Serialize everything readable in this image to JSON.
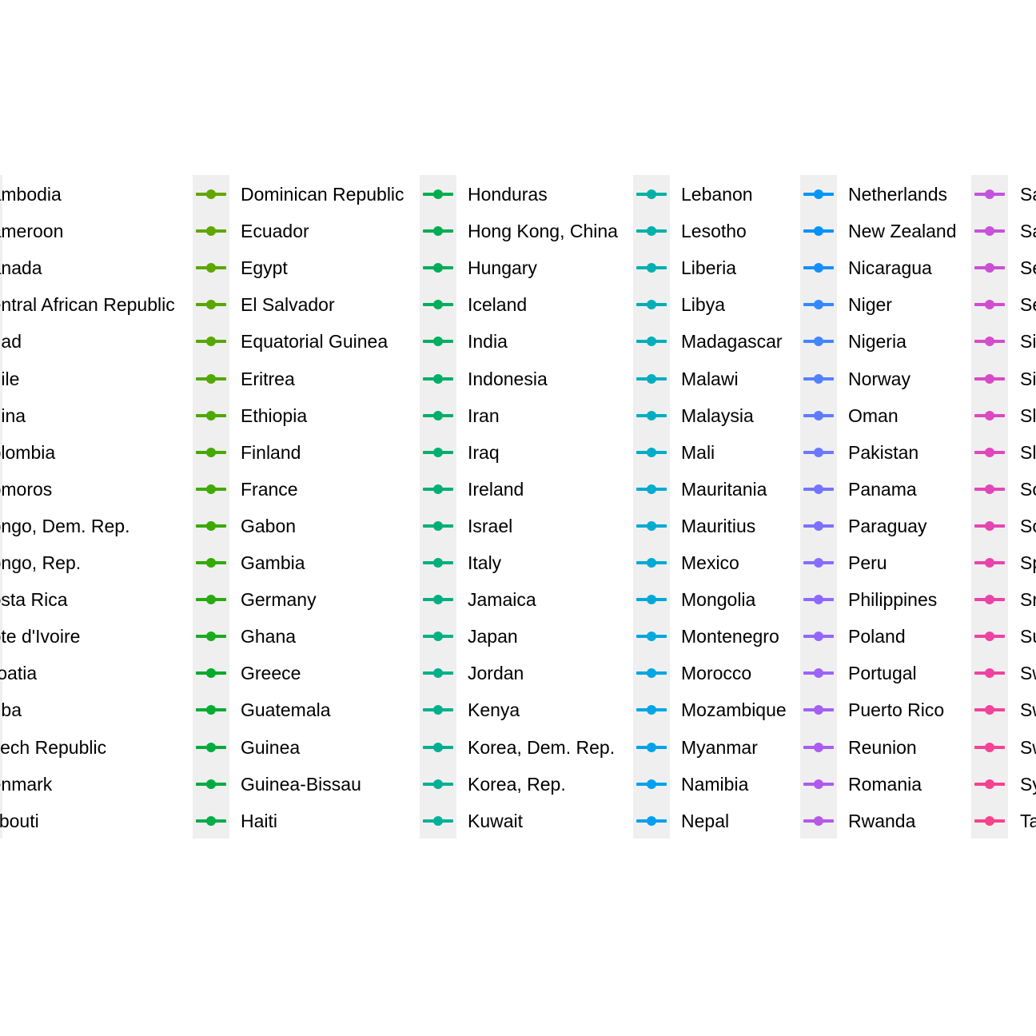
{
  "chart_data": {
    "type": "line",
    "legend_position": "center",
    "legend_columns": [
      {
        "entries": [
          {
            "name": "Cambodia",
            "color": "#8b9a00"
          },
          {
            "name": "Cameroon",
            "color": "#8a9b00"
          },
          {
            "name": "Canada",
            "color": "#889c00"
          },
          {
            "name": "Central African Republic",
            "color": "#869c00"
          },
          {
            "name": "Chad",
            "color": "#849d00"
          },
          {
            "name": "Chile",
            "color": "#829e00"
          },
          {
            "name": "China",
            "color": "#809f00"
          },
          {
            "name": "Colombia",
            "color": "#7e9f00"
          },
          {
            "name": "Comoros",
            "color": "#7ca000"
          },
          {
            "name": "Congo, Dem. Rep.",
            "color": "#7aa100"
          },
          {
            "name": "Congo, Rep.",
            "color": "#78a100"
          },
          {
            "name": "Costa Rica",
            "color": "#75a200"
          },
          {
            "name": "Cote d'Ivoire",
            "color": "#73a300"
          },
          {
            "name": "Croatia",
            "color": "#71a300"
          },
          {
            "name": "Cuba",
            "color": "#6ea400"
          },
          {
            "name": "Czech Republic",
            "color": "#6ba400"
          },
          {
            "name": "Denmark",
            "color": "#69a500"
          },
          {
            "name": "Djibouti",
            "color": "#66a500"
          }
        ]
      },
      {
        "entries": [
          {
            "name": "Dominican Republic",
            "color": "#63a600"
          },
          {
            "name": "Ecuador",
            "color": "#60a600"
          },
          {
            "name": "Egypt",
            "color": "#5ca700"
          },
          {
            "name": "El Salvador",
            "color": "#59a700"
          },
          {
            "name": "Equatorial Guinea",
            "color": "#55a800"
          },
          {
            "name": "Eritrea",
            "color": "#51a800"
          },
          {
            "name": "Ethiopia",
            "color": "#4ca900"
          },
          {
            "name": "Finland",
            "color": "#47a900"
          },
          {
            "name": "France",
            "color": "#41aa00"
          },
          {
            "name": "Gabon",
            "color": "#3aaa00"
          },
          {
            "name": "Gambia",
            "color": "#32aa00"
          },
          {
            "name": "Germany",
            "color": "#27ab0f"
          },
          {
            "name": "Ghana",
            "color": "#1aab1f"
          },
          {
            "name": "Greece",
            "color": "#00ab29"
          },
          {
            "name": "Guatemala",
            "color": "#00ac32"
          },
          {
            "name": "Guinea",
            "color": "#00ac3a"
          },
          {
            "name": "Guinea-Bissau",
            "color": "#00ac41"
          },
          {
            "name": "Haiti",
            "color": "#00ad47"
          }
        ]
      },
      {
        "entries": [
          {
            "name": "Honduras",
            "color": "#00ad4d"
          },
          {
            "name": "Hong Kong, China",
            "color": "#00ad53"
          },
          {
            "name": "Hungary",
            "color": "#00ad58"
          },
          {
            "name": "Iceland",
            "color": "#00ae5d"
          },
          {
            "name": "India",
            "color": "#00ae62"
          },
          {
            "name": "Indonesia",
            "color": "#00ae67"
          },
          {
            "name": "Iran",
            "color": "#00ae6b"
          },
          {
            "name": "Iraq",
            "color": "#00af70"
          },
          {
            "name": "Ireland",
            "color": "#00af74"
          },
          {
            "name": "Israel",
            "color": "#00af78"
          },
          {
            "name": "Italy",
            "color": "#00af7d"
          },
          {
            "name": "Jamaica",
            "color": "#00af81"
          },
          {
            "name": "Japan",
            "color": "#00b085"
          },
          {
            "name": "Jordan",
            "color": "#00b089"
          },
          {
            "name": "Kenya",
            "color": "#00b08d"
          },
          {
            "name": "Korea, Dem. Rep.",
            "color": "#00b091"
          },
          {
            "name": "Korea, Rep.",
            "color": "#00b095"
          },
          {
            "name": "Kuwait",
            "color": "#00b099"
          }
        ]
      },
      {
        "entries": [
          {
            "name": "Lebanon",
            "color": "#00b0a5"
          },
          {
            "name": "Lesotho",
            "color": "#00b0aa"
          },
          {
            "name": "Liberia",
            "color": "#00b0b0"
          },
          {
            "name": "Libya",
            "color": "#00afb5"
          },
          {
            "name": "Madagascar",
            "color": "#00afba"
          },
          {
            "name": "Malawi",
            "color": "#00aebf"
          },
          {
            "name": "Malaysia",
            "color": "#00aec4"
          },
          {
            "name": "Mali",
            "color": "#00adc9"
          },
          {
            "name": "Mauritania",
            "color": "#00acce"
          },
          {
            "name": "Mauritius",
            "color": "#00abd2"
          },
          {
            "name": "Mexico",
            "color": "#00aad6"
          },
          {
            "name": "Mongolia",
            "color": "#00a9da"
          },
          {
            "name": "Montenegro",
            "color": "#00a8de"
          },
          {
            "name": "Morocco",
            "color": "#00a7e2"
          },
          {
            "name": "Mozambique",
            "color": "#00a5e6"
          },
          {
            "name": "Myanmar",
            "color": "#00a3ea"
          },
          {
            "name": "Namibia",
            "color": "#00a1ee"
          },
          {
            "name": "Nepal",
            "color": "#009ff1"
          }
        ]
      },
      {
        "entries": [
          {
            "name": "Netherlands",
            "color": "#0096f8"
          },
          {
            "name": "New Zealand",
            "color": "#0092fb"
          },
          {
            "name": "Nicaragua",
            "color": "#178efd"
          },
          {
            "name": "Niger",
            "color": "#3389ff"
          },
          {
            "name": "Nigeria",
            "color": "#4485ff"
          },
          {
            "name": "Norway",
            "color": "#5380ff"
          },
          {
            "name": "Oman",
            "color": "#5f7cff"
          },
          {
            "name": "Pakistan",
            "color": "#6a78ff"
          },
          {
            "name": "Panama",
            "color": "#7474ff"
          },
          {
            "name": "Paraguay",
            "color": "#7d70ff"
          },
          {
            "name": "Peru",
            "color": "#866cff"
          },
          {
            "name": "Philippines",
            "color": "#8e69ff"
          },
          {
            "name": "Poland",
            "color": "#9566fb"
          },
          {
            "name": "Portugal",
            "color": "#9c63f8"
          },
          {
            "name": "Puerto Rico",
            "color": "#a360f4"
          },
          {
            "name": "Reunion",
            "color": "#aa5df0"
          },
          {
            "name": "Romania",
            "color": "#b05beb"
          },
          {
            "name": "Rwanda",
            "color": "#b658e7"
          }
        ]
      },
      {
        "entries": [
          {
            "name": "Sa",
            "color": "#c453de"
          },
          {
            "name": "Sa",
            "color": "#c851da"
          },
          {
            "name": "Se",
            "color": "#cd4fd5"
          },
          {
            "name": "Se",
            "color": "#d14dd0"
          },
          {
            "name": "Si",
            "color": "#d54ccb"
          },
          {
            "name": "Si",
            "color": "#d94ac6"
          },
          {
            "name": "Sl",
            "color": "#dc49c1"
          },
          {
            "name": "Sl",
            "color": "#e047bc"
          },
          {
            "name": "So",
            "color": "#e346b7"
          },
          {
            "name": "So",
            "color": "#e645b2"
          },
          {
            "name": "Sp",
            "color": "#e944ad"
          },
          {
            "name": "Sr",
            "color": "#ec43a8"
          },
          {
            "name": "Su",
            "color": "#ee43a3"
          },
          {
            "name": "Sw",
            "color": "#f0429e"
          },
          {
            "name": "Sw",
            "color": "#f24299"
          },
          {
            "name": "Sw",
            "color": "#f44294"
          },
          {
            "name": "Sy",
            "color": "#f6428f"
          },
          {
            "name": "Ta",
            "color": "#f8428a"
          }
        ]
      }
    ]
  }
}
